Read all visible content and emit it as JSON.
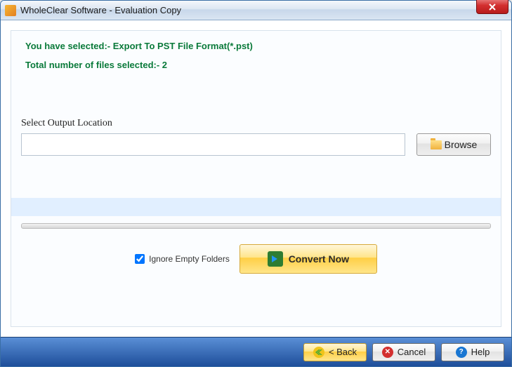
{
  "titlebar": {
    "title": "WholeClear Software - Evaluation Copy"
  },
  "info": {
    "line1": "You have selected:- Export To PST File Format(*.pst)",
    "line2": "Total number of files selected:- 2"
  },
  "output": {
    "label": "Select Output Location",
    "value": "",
    "browse_label": "Browse"
  },
  "options": {
    "ignore_empty_label": "Ignore Empty Folders",
    "ignore_empty_checked": true
  },
  "actions": {
    "convert_label": "Convert Now"
  },
  "footer": {
    "back_label": "< Back",
    "cancel_label": "Cancel",
    "help_label": "Help"
  }
}
